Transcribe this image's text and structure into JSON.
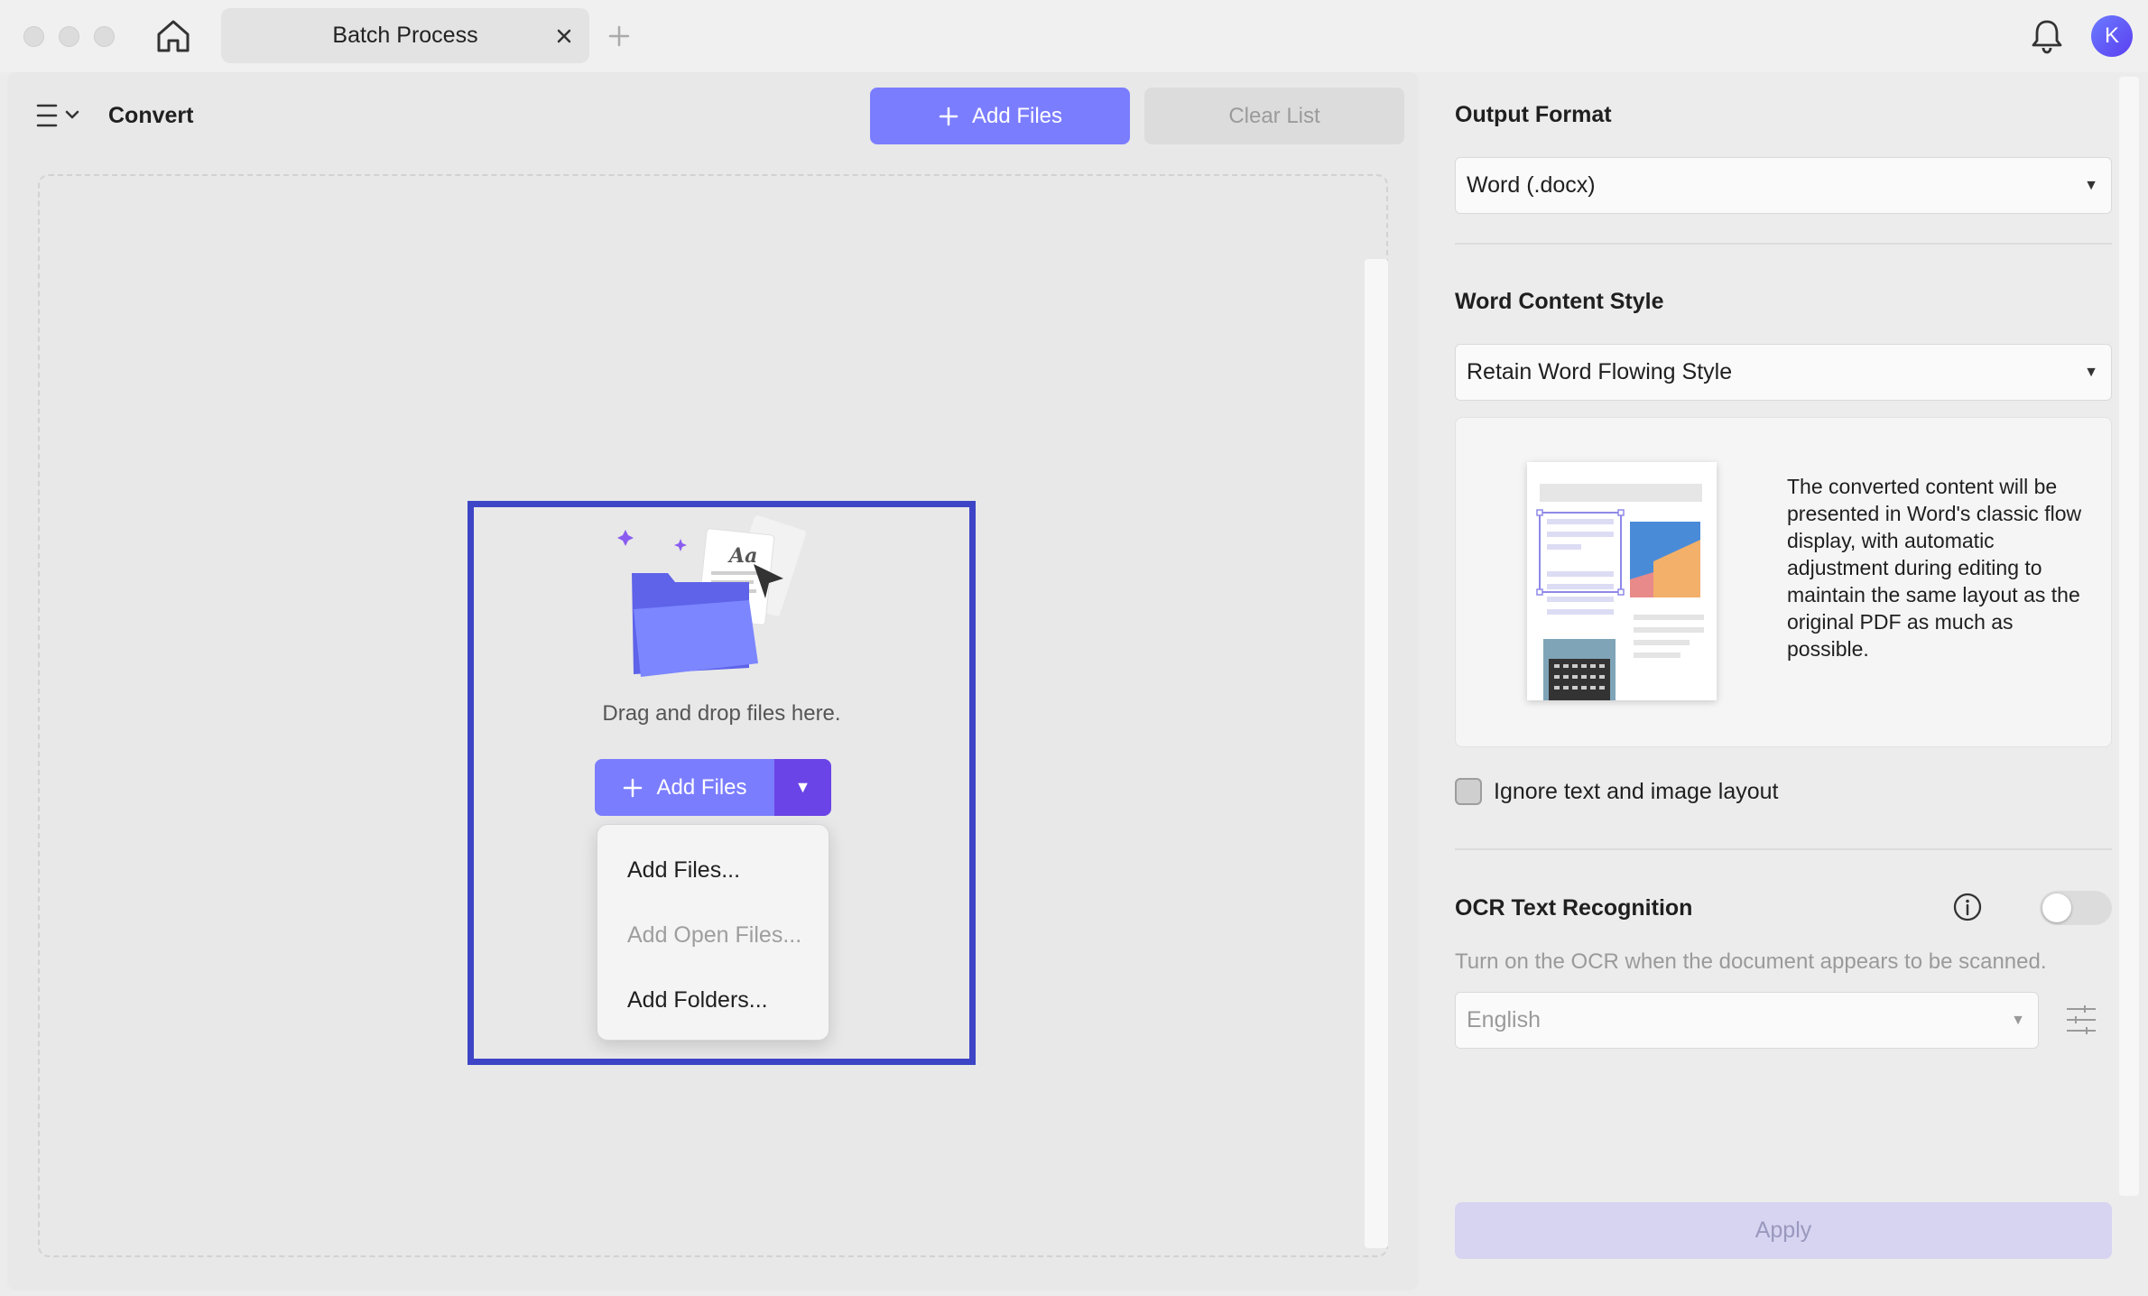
{
  "window": {
    "tab_title": "Batch Process",
    "avatar_initial": "K"
  },
  "left": {
    "title": "Convert",
    "add_files_label": "Add Files",
    "clear_list_label": "Clear List",
    "dropzone": {
      "drag_text": "Drag and drop files here.",
      "add_files_label": "Add Files",
      "menu": [
        "Add Files...",
        "Add Open Files...",
        "Add Folders..."
      ],
      "illustration_text": "Aa"
    }
  },
  "right": {
    "output_format_title": "Output Format",
    "output_format_value": "Word (.docx)",
    "word_style_title": "Word Content Style",
    "word_style_value": "Retain Word Flowing Style",
    "style_description": "The converted content will be presented in Word's classic flow display, with automatic adjustment during editing to maintain the same layout as the original PDF as much as possible.",
    "ignore_layout_label": "Ignore text and image layout",
    "ocr_title": "OCR Text Recognition",
    "ocr_enabled": false,
    "ocr_hint": "Turn on the OCR when the document appears to be scanned.",
    "ocr_language": "English",
    "apply_label": "Apply"
  },
  "colors": {
    "accent": "#7b7dff",
    "accent_dark": "#6a44e6",
    "highlight": "#3d45c6"
  }
}
